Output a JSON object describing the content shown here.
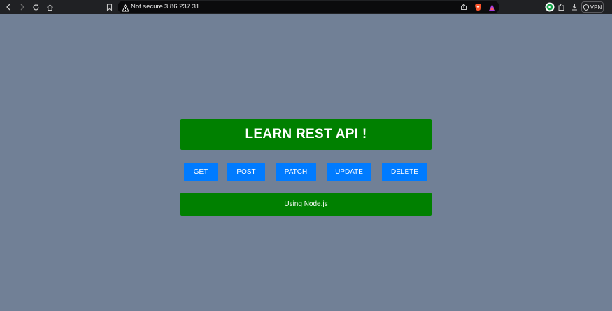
{
  "browser": {
    "security_label": "Not secure",
    "url": "3.86.237.31",
    "vpn_label": "VPN"
  },
  "page": {
    "title": "LEARN REST API !",
    "buttons": [
      "GET",
      "POST",
      "PATCH",
      "UPDATE",
      "DELETE"
    ],
    "footer": "Using Node.js"
  },
  "colors": {
    "background": "#718096",
    "green": "#008000",
    "button_blue": "#007bff"
  },
  "icons": [
    "back-icon",
    "forward-icon",
    "reload-icon",
    "home-icon",
    "bookmark-icon",
    "warning-icon",
    "share-icon",
    "brave-icon",
    "rewards-icon",
    "extension-badge-icon",
    "extensions-icon",
    "download-icon"
  ]
}
